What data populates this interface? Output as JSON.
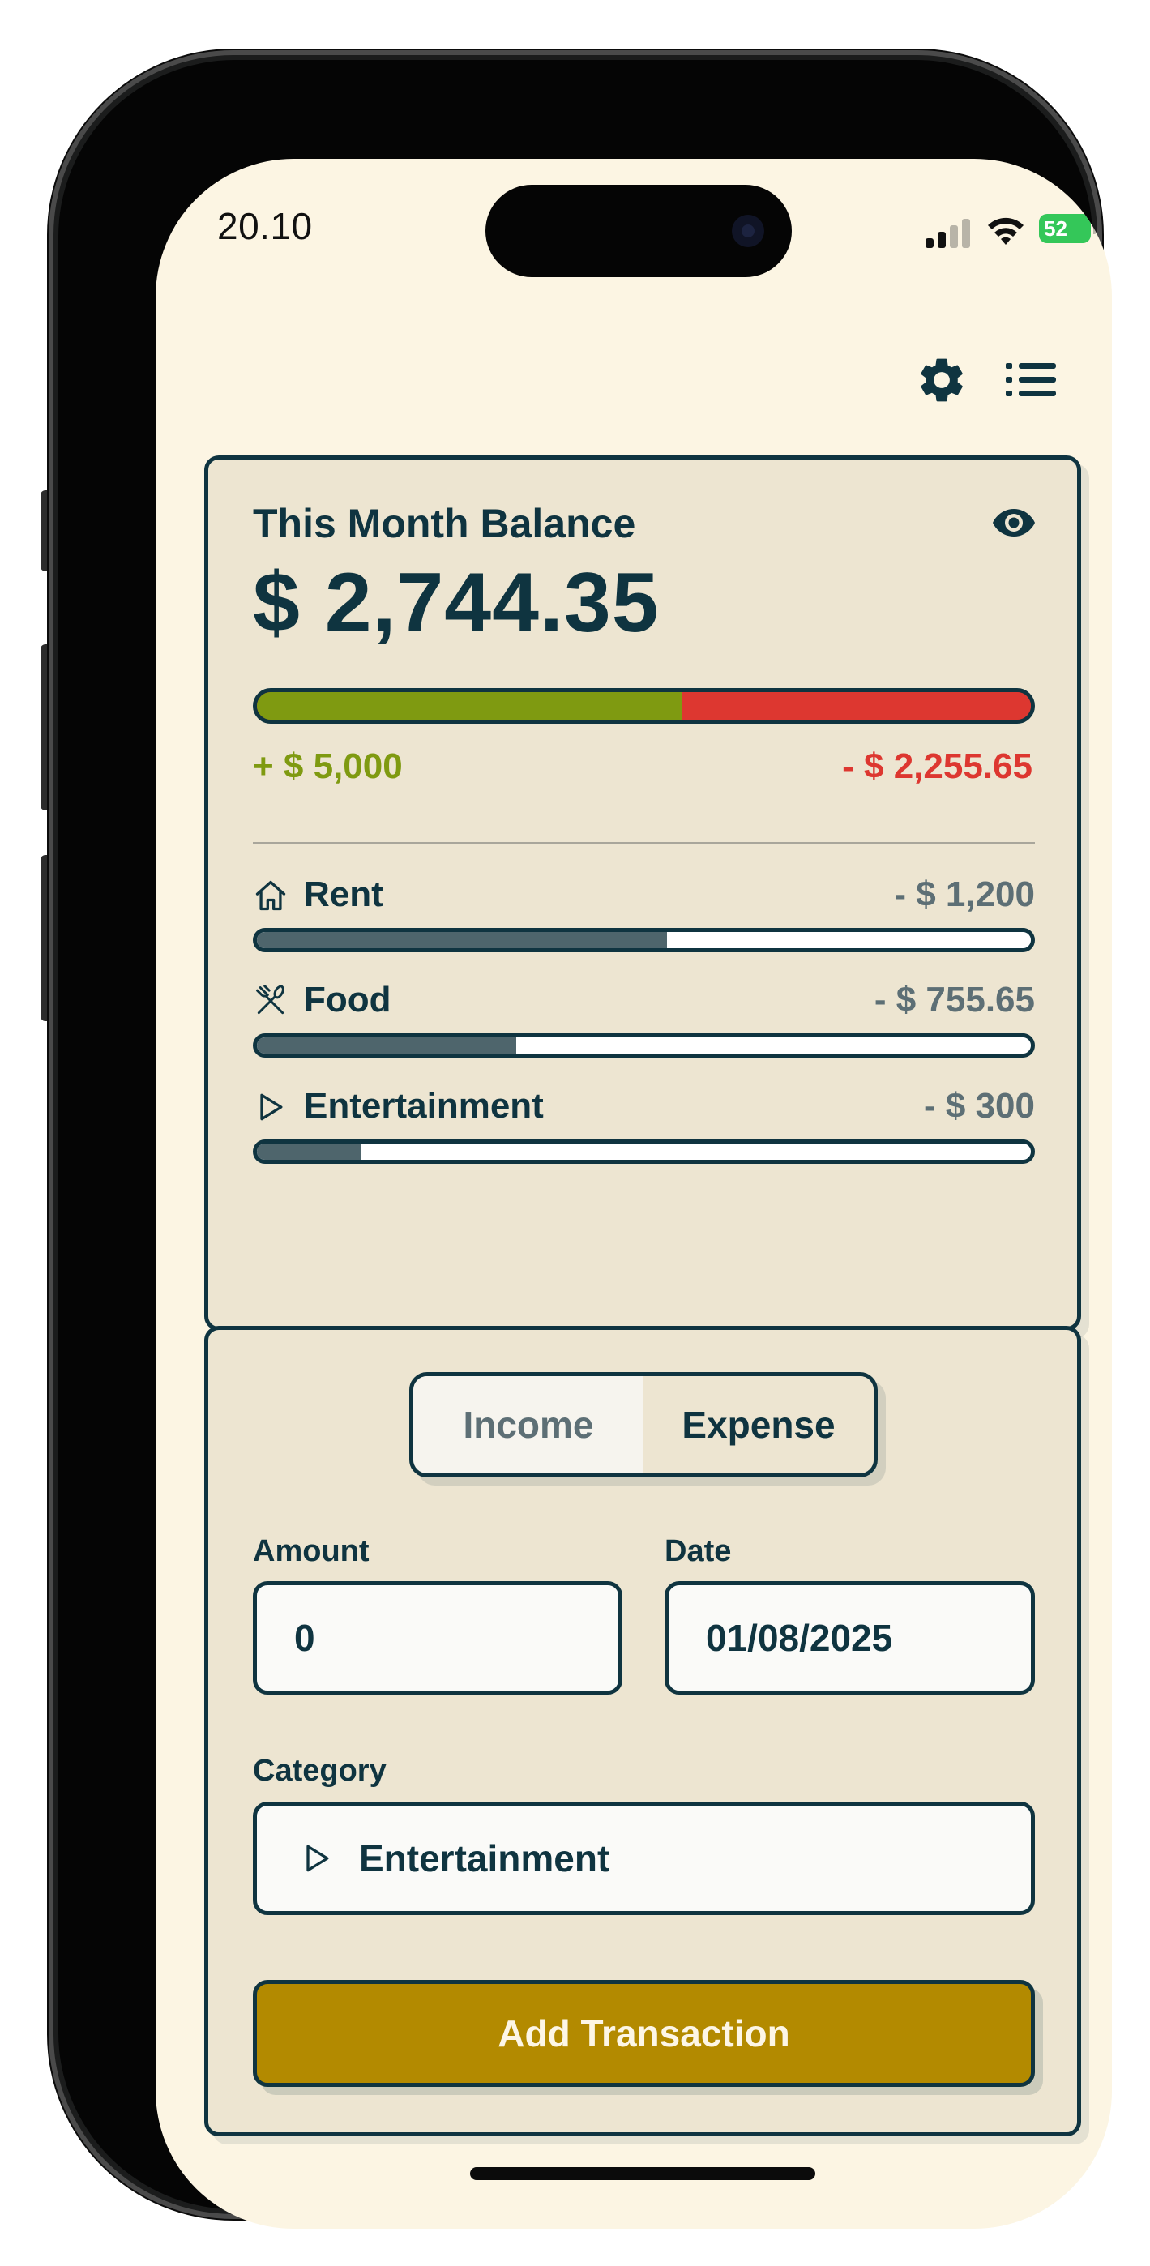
{
  "status_bar": {
    "time": "20.10",
    "battery": "52"
  },
  "icons": {
    "settings": "gear-icon",
    "menu": "list-icon",
    "visibility": "eye-icon",
    "rent": "house-icon",
    "food": "fork-knife-icon",
    "entertainment": "play-icon"
  },
  "balance": {
    "title": "This Month Balance",
    "amount": "$ 2,744.35",
    "income_label": "+ $ 5,000",
    "expense_label": "- $ 2,255.65",
    "income_share": 0.55,
    "categories": [
      {
        "name": "Rent",
        "amount": "- $ 1,200",
        "fraction": 0.53
      },
      {
        "name": "Food",
        "amount": "- $ 755.65",
        "fraction": 0.335
      },
      {
        "name": "Entertainment",
        "amount": "- $ 300",
        "fraction": 0.135
      }
    ]
  },
  "form": {
    "tabs": [
      "Income",
      "Expense"
    ],
    "selected_tab": "Expense",
    "amount_label": "Amount",
    "amount_value": "0",
    "date_label": "Date",
    "date_value": "01/08/2025",
    "category_label": "Category",
    "category_value": "Entertainment",
    "submit_label": "Add Transaction"
  },
  "colors": {
    "background": "#fcf5e3",
    "card": "#ede5d1",
    "ink": "#0f3440",
    "income": "#7f9a11",
    "expense": "#dd3730",
    "accent_button": "#b38a00",
    "category_fill": "#4e656c"
  }
}
